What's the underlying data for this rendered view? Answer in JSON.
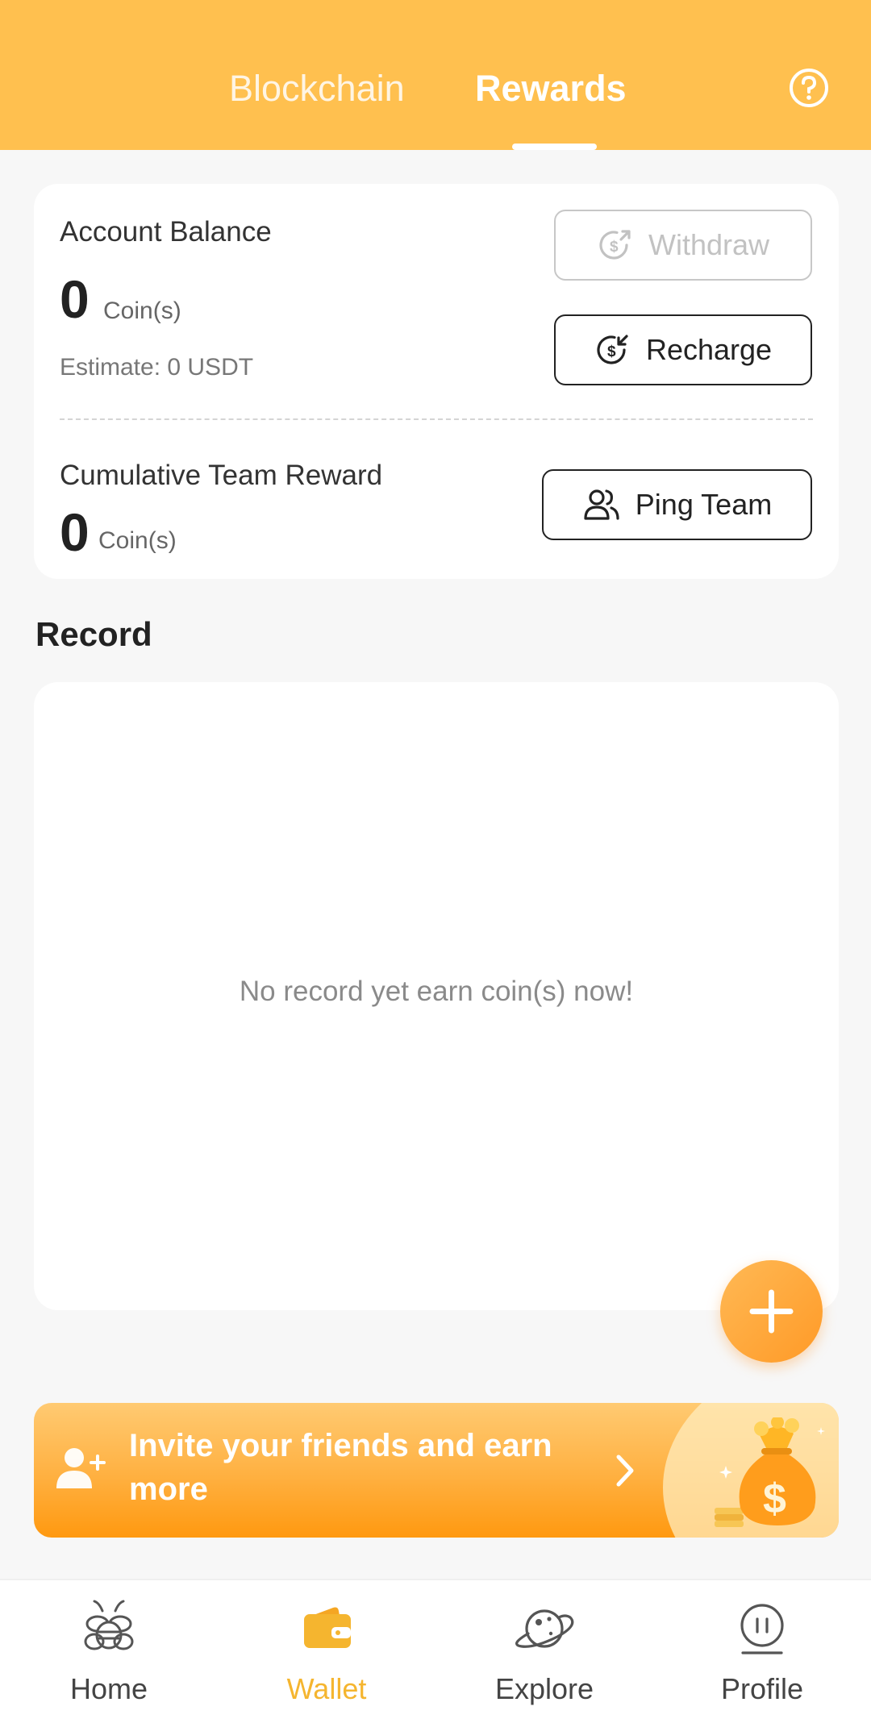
{
  "header": {
    "tabs": [
      {
        "label": "Blockchain",
        "active": false
      },
      {
        "label": "Rewards",
        "active": true
      }
    ],
    "help_icon": "question-circle-icon",
    "accent_color": "#ffc04f"
  },
  "balance": {
    "title": "Account Balance",
    "amount": "0",
    "unit": "Coin(s)",
    "estimate": "Estimate: 0 USDT",
    "withdraw_label": "Withdraw",
    "withdraw_enabled": false,
    "recharge_label": "Recharge"
  },
  "team": {
    "title": "Cumulative Team Reward",
    "amount": "0",
    "unit": "Coin(s)",
    "button_label": "Ping Team"
  },
  "record": {
    "title": "Record",
    "empty_text": "No record yet earn coin(s) now!"
  },
  "fab": {
    "icon": "plus-icon"
  },
  "invite": {
    "text": "Invite your friends and earn more",
    "icon": "add-user-icon",
    "arrow_icon": "chevron-right-icon",
    "illustration": "money-bag-icon"
  },
  "bottom_nav": {
    "items": [
      {
        "label": "Home",
        "icon": "bee-icon",
        "active": false
      },
      {
        "label": "Wallet",
        "icon": "wallet-icon",
        "active": true
      },
      {
        "label": "Explore",
        "icon": "planet-icon",
        "active": false
      },
      {
        "label": "Profile",
        "icon": "profile-icon",
        "active": false
      }
    ]
  }
}
